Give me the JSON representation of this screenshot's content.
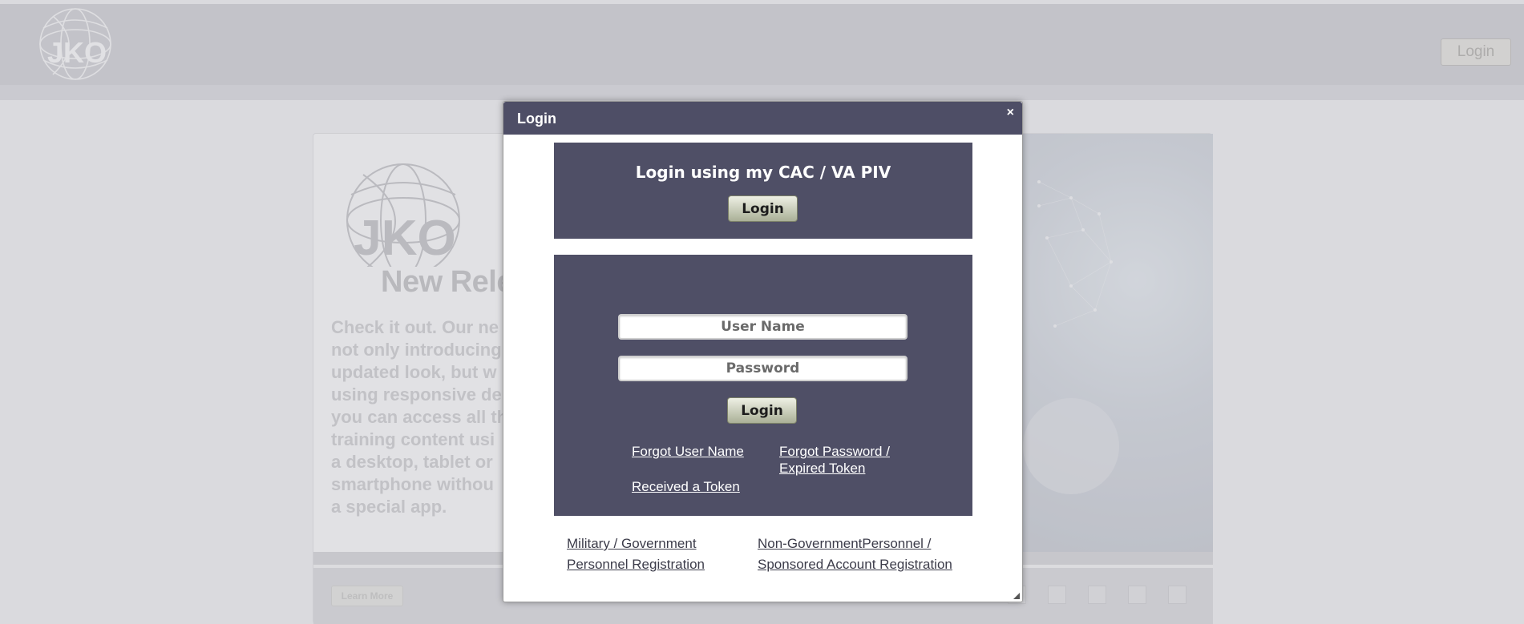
{
  "header": {
    "logo_text": "JKO",
    "login_button": "Login"
  },
  "promo": {
    "logo_text": "JKO",
    "heading": "New Rele",
    "lines": [
      "Check it out. Our ne",
      "not only introducing",
      "updated look, but w",
      "using responsive de",
      "you can access all th",
      "training content usi",
      "a desktop, tablet or",
      "smartphone withou",
      "a special app."
    ],
    "learn_more": "Learn More"
  },
  "modal": {
    "title": "Login",
    "close_symbol": "×",
    "cac": {
      "heading": "Login using my CAC / VA PIV",
      "button": "Login"
    },
    "credentials": {
      "username_placeholder": "User Name",
      "password_placeholder": "Password",
      "button": "Login",
      "forgot_username": "Forgot User Name",
      "forgot_password": "Forgot Password / Expired Token",
      "received_token": "Received a Token"
    },
    "registration": {
      "military": "Military / Government Personnel Registration",
      "non_government": "Non-GovernmentPersonnel / Sponsored Account Registration"
    }
  },
  "colors": {
    "modal_header": "#4e4e66",
    "box_bg": "#4f4f66",
    "button_gradient_top": "#eef0e4",
    "button_gradient_bottom": "#aab097"
  }
}
